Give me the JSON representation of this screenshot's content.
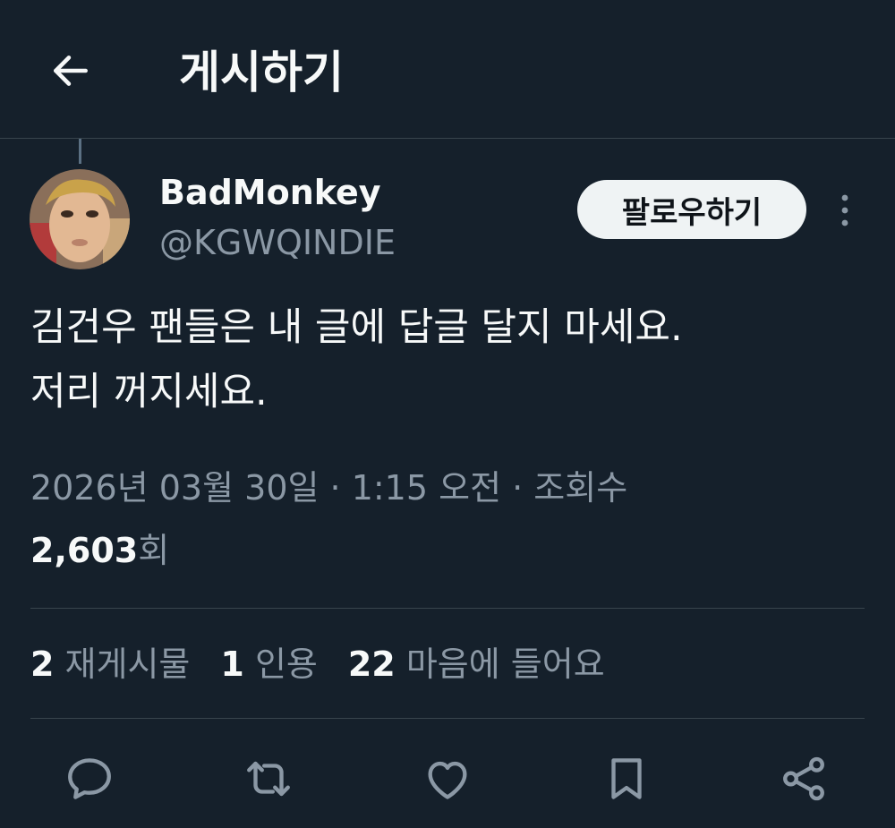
{
  "header": {
    "title": "게시하기",
    "back_icon": "arrow-left-icon"
  },
  "author": {
    "display_name": "BadMonkey",
    "handle": "@KGWQINDIE",
    "follow_label": "팔로우하기",
    "more_icon": "more-vertical-icon"
  },
  "tweet": {
    "lines": [
      "김건우 팬들은 내 글에 답글 달지 마세요.",
      "저리 꺼지세요."
    ]
  },
  "meta": {
    "date": "2026년 03월 30일",
    "separator": " · ",
    "time": "1:15 오전",
    "views_label": "조회수",
    "views_count": "2,603",
    "views_unit": "회"
  },
  "stats": {
    "reposts_count": "2",
    "reposts_label": "재게시물",
    "quotes_count": "1",
    "quotes_label": "인용",
    "likes_count": "22",
    "likes_label": "마음에 들어요"
  },
  "actions": {
    "reply_icon": "reply-icon",
    "repost_icon": "repost-icon",
    "like_icon": "heart-icon",
    "bookmark_icon": "bookmark-icon",
    "share_icon": "share-icon"
  },
  "colors": {
    "background": "#15202b",
    "text": "#f7f9f9",
    "secondary": "#8b98a5",
    "divider": "#38444d",
    "follow_bg": "#eff3f4"
  }
}
